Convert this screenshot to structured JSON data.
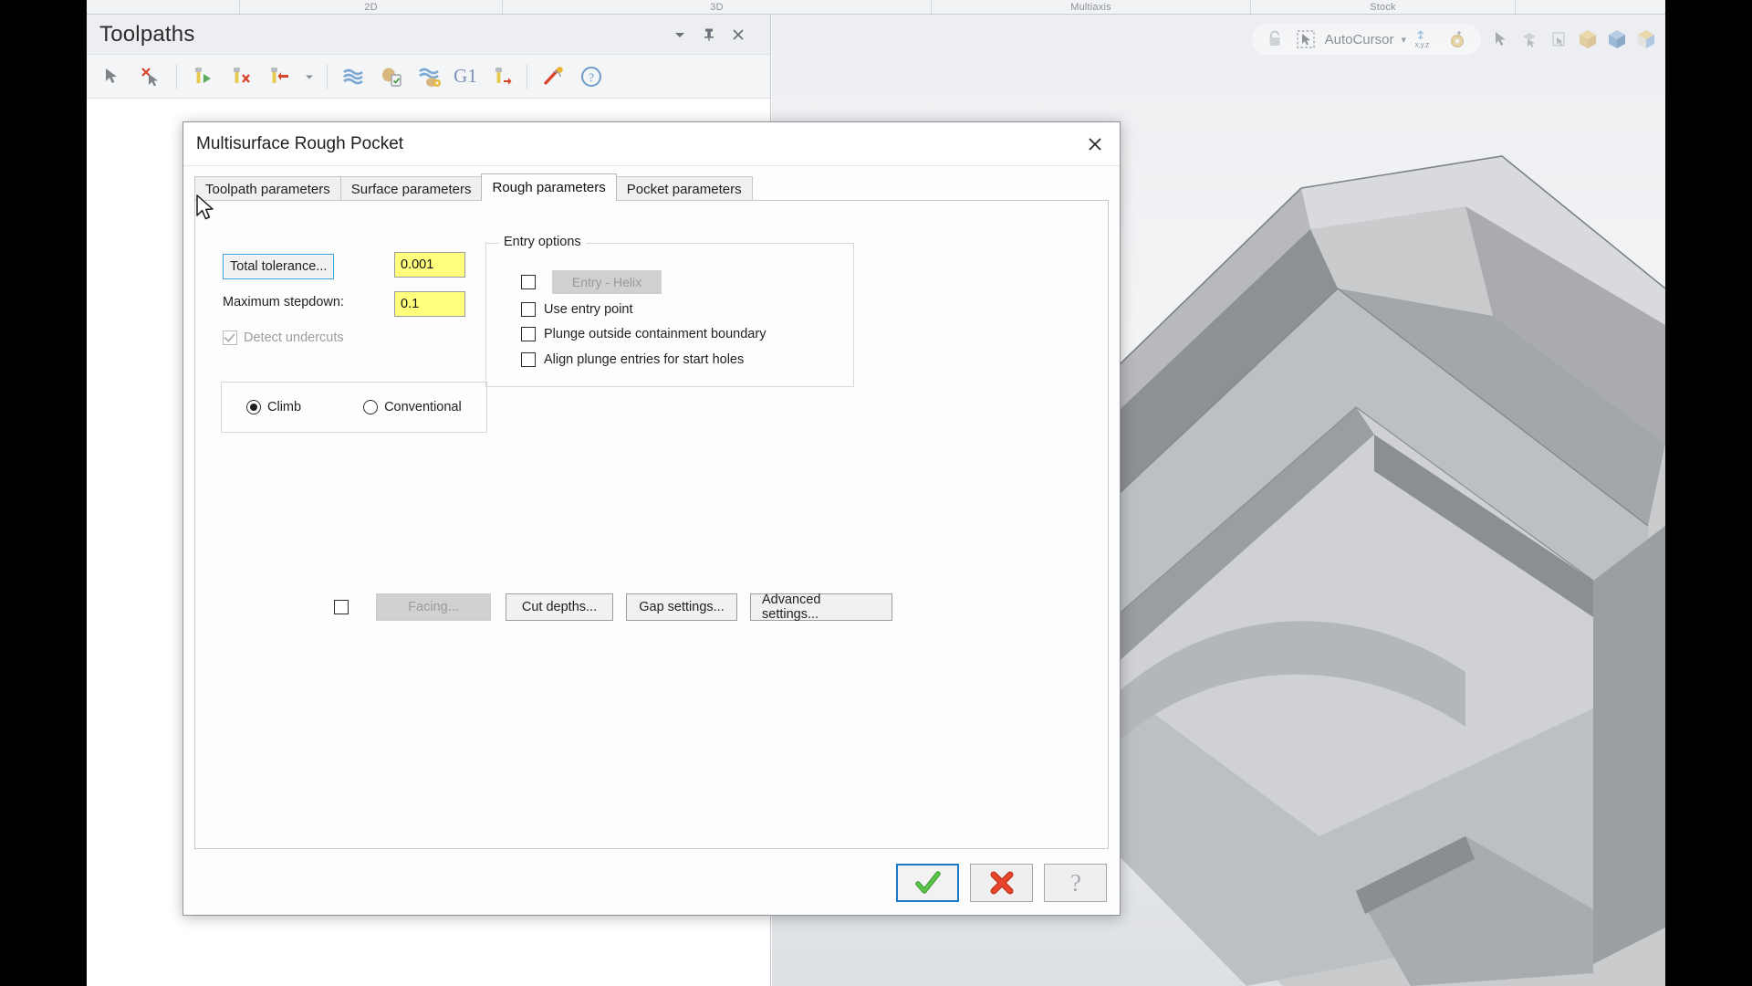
{
  "ribbon": {
    "groups": [
      {
        "label": ""
      },
      {
        "label": "2D"
      },
      {
        "label": "3D"
      },
      {
        "label": "Multiaxis"
      },
      {
        "label": "Stock"
      },
      {
        "label": ""
      }
    ]
  },
  "toolpaths_panel": {
    "title": "Toolpaths",
    "header_icons": [
      {
        "name": "chevron-down-icon",
        "glyph": "▾"
      },
      {
        "name": "pin-icon",
        "glyph": "📌"
      },
      {
        "name": "close-icon",
        "glyph": "✕"
      }
    ],
    "toolbar": {
      "g1_label": "G1",
      "buttons": [
        {
          "name": "select-toolpath-icon"
        },
        {
          "name": "deselect-toolpath-icon"
        },
        {
          "name": "regenerate-toolpath-icon"
        },
        {
          "name": "delete-toolpath-icon"
        },
        {
          "name": "move-toolpath-icon"
        },
        {
          "name": "toolbar-dropdown-icon"
        },
        {
          "name": "verify-toolpath-icon"
        },
        {
          "name": "post-toolpath-icon"
        },
        {
          "name": "simulate-toolpath-icon"
        },
        {
          "name": "g1-backplot-icon"
        },
        {
          "name": "tool-manager-icon"
        },
        {
          "name": "high-speed-toolpath-icon"
        },
        {
          "name": "help-icon"
        }
      ]
    }
  },
  "viewport": {
    "autocursor_label": "AutoCursor",
    "dropdown_glyph": "▾",
    "xyz_label": "x,y,z",
    "icons": [
      {
        "name": "lock-icon"
      },
      {
        "name": "autocursor-icon"
      },
      {
        "name": "xyz-coordinate-icon"
      },
      {
        "name": "gear-settings-icon"
      },
      {
        "name": "select-arrow-icon"
      },
      {
        "name": "select-face-icon"
      },
      {
        "name": "select-edge-icon"
      },
      {
        "name": "shade-solid-icon"
      },
      {
        "name": "shade-blue-icon"
      },
      {
        "name": "shade-translucent-icon"
      }
    ]
  },
  "dialog": {
    "title": "Multisurface Rough Pocket",
    "close_glyph": "✕",
    "tabs": [
      {
        "label": "Toolpath parameters",
        "active": false
      },
      {
        "label": "Surface parameters",
        "active": false
      },
      {
        "label": "Rough parameters",
        "active": true
      },
      {
        "label": "Pocket parameters",
        "active": false
      }
    ],
    "rough_parameters": {
      "total_tolerance_button": "Total tolerance...",
      "total_tolerance_value": "0.001",
      "maximum_stepdown_label": "Maximum stepdown:",
      "maximum_stepdown_value": "0.1",
      "detect_undercuts_label": "Detect undercuts",
      "detect_undercuts_checked": true,
      "detect_undercuts_disabled": true,
      "cut_direction": {
        "climb_label": "Climb",
        "conventional_label": "Conventional",
        "selected": "Climb"
      },
      "entry_options": {
        "legend": "Entry options",
        "helix_checkbox_checked": false,
        "helix_button_label": "Entry - Helix",
        "helix_button_disabled": true,
        "items": [
          {
            "label": "Use entry point",
            "checked": false
          },
          {
            "label": "Plunge outside containment boundary",
            "checked": false
          },
          {
            "label": "Align plunge entries for start holes",
            "checked": false
          }
        ]
      },
      "action_row": {
        "facing_checkbox_checked": false,
        "facing_label": "Facing...",
        "facing_disabled": true,
        "cut_depths_label": "Cut depths...",
        "gap_settings_label": "Gap settings...",
        "advanced_settings_label": "Advanced settings..."
      }
    },
    "footer": {
      "ok_name": "ok-check-icon",
      "cancel_name": "cancel-x-icon",
      "help_name": "help-question-icon"
    }
  },
  "colors": {
    "field_yellow": "#ffff7d",
    "focus_blue": "#1879c8",
    "ok_green": "#44b53c",
    "cancel_red": "#e2402a"
  }
}
